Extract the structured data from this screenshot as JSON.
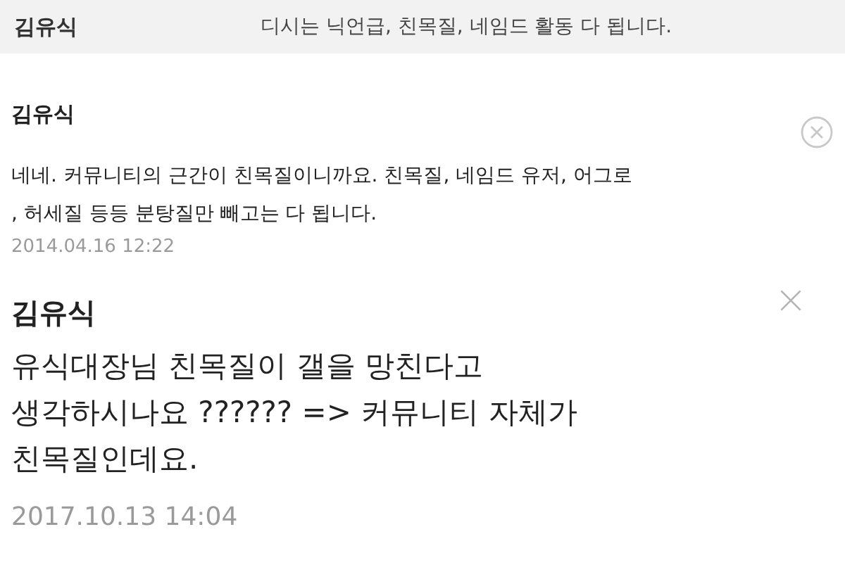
{
  "header": {
    "author": "김유식",
    "text": "디시는 닉언급, 친목질, 네임드 활동 다 됩니다."
  },
  "comments": [
    {
      "kind": "compact",
      "author": "김유식",
      "body": "네네. 커뮤니티의 근간이 친목질이니까요. 친목질, 네임드 유저, 어그로\n, 허세질 등등 분탕질만 빼고는 다 됩니다.",
      "date": "2014.04.16 12:22"
    },
    {
      "kind": "large",
      "author": "김유식",
      "body": "유식대장님 친목질이 갤을 망친다고\n생각하시나요 ?????? => 커뮤니티 자체가\n친목질인데요.",
      "date": "2017.10.13 14:04"
    }
  ]
}
